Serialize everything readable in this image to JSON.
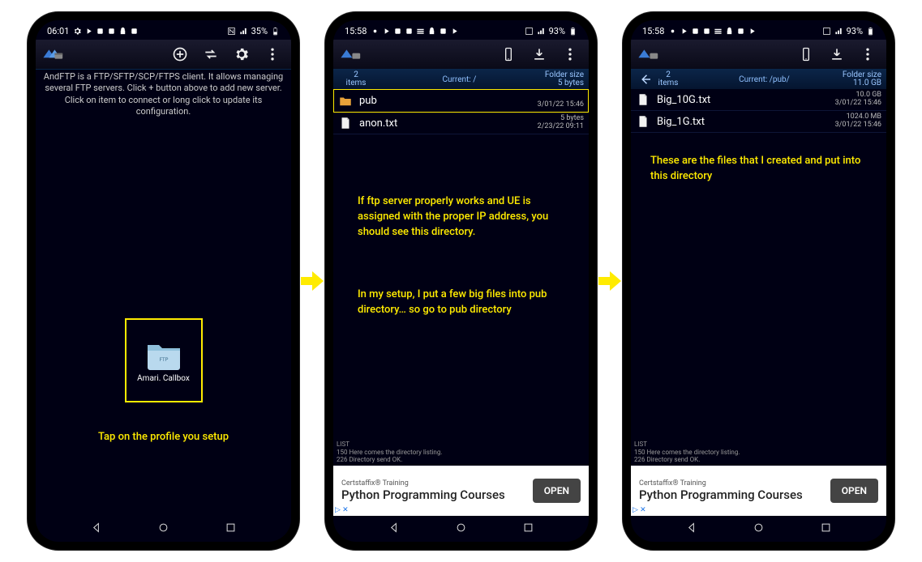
{
  "phones": [
    {
      "status": {
        "time": "06:01",
        "signal": "35%"
      },
      "intro": "AndFTP is a FTP/SFTP/SCP/FTPS client. It allows managing several FTP servers. Click + button above to add new server. Click on item to connect or long click to update its configuration.",
      "profile": {
        "label": "Amari. Callbox"
      },
      "caption": "Tap on the profile you setup"
    },
    {
      "status": {
        "time": "15:58",
        "signal": "93%"
      },
      "header": {
        "count": "2",
        "count_label": "items",
        "path": "Current: /",
        "right_top": "Folder size",
        "right_bot": "5 bytes"
      },
      "rows": [
        {
          "name": "pub",
          "meta_top": "",
          "meta_bot": "3/01/22 15:46",
          "kind": "folder",
          "hl": true
        },
        {
          "name": "anon.txt",
          "meta_top": "5 bytes",
          "meta_bot": "2/23/22 09:11",
          "kind": "file",
          "hl": false
        }
      ],
      "captions": [
        "If ftp server properly works and UE is assigned with the proper IP address, you should see this directory.",
        "In my setup, I put a few big files into pub directory… so go to pub directory"
      ],
      "log": {
        "l1": "LIST",
        "l2": "150 Here comes the directory listing.",
        "l3": "226 Directory send OK."
      },
      "ad": {
        "brand": "Certstaffix® Training",
        "title": "Python Programming Courses",
        "cta": "OPEN"
      }
    },
    {
      "status": {
        "time": "15:58",
        "signal": "93%"
      },
      "header": {
        "count": "2",
        "count_label": "items",
        "path": "Current: /pub/",
        "right_top": "Folder size",
        "right_bot": "11.0 GB",
        "back": true
      },
      "rows": [
        {
          "name": "Big_10G.txt",
          "meta_top": "10.0 GB",
          "meta_bot": "3/01/22 15:46",
          "kind": "file",
          "hl": false
        },
        {
          "name": "Big_1G.txt",
          "meta_top": "1024.0 MB",
          "meta_bot": "3/01/22 15:46",
          "kind": "file",
          "hl": false
        }
      ],
      "captions": [
        "These are the files that I created and put into this directory"
      ],
      "log": {
        "l1": "LIST",
        "l2": "150 Here comes the directory listing.",
        "l3": "226 Directory send OK."
      },
      "ad": {
        "brand": "Certstaffix® Training",
        "title": "Python Programming Courses",
        "cta": "OPEN"
      }
    }
  ]
}
